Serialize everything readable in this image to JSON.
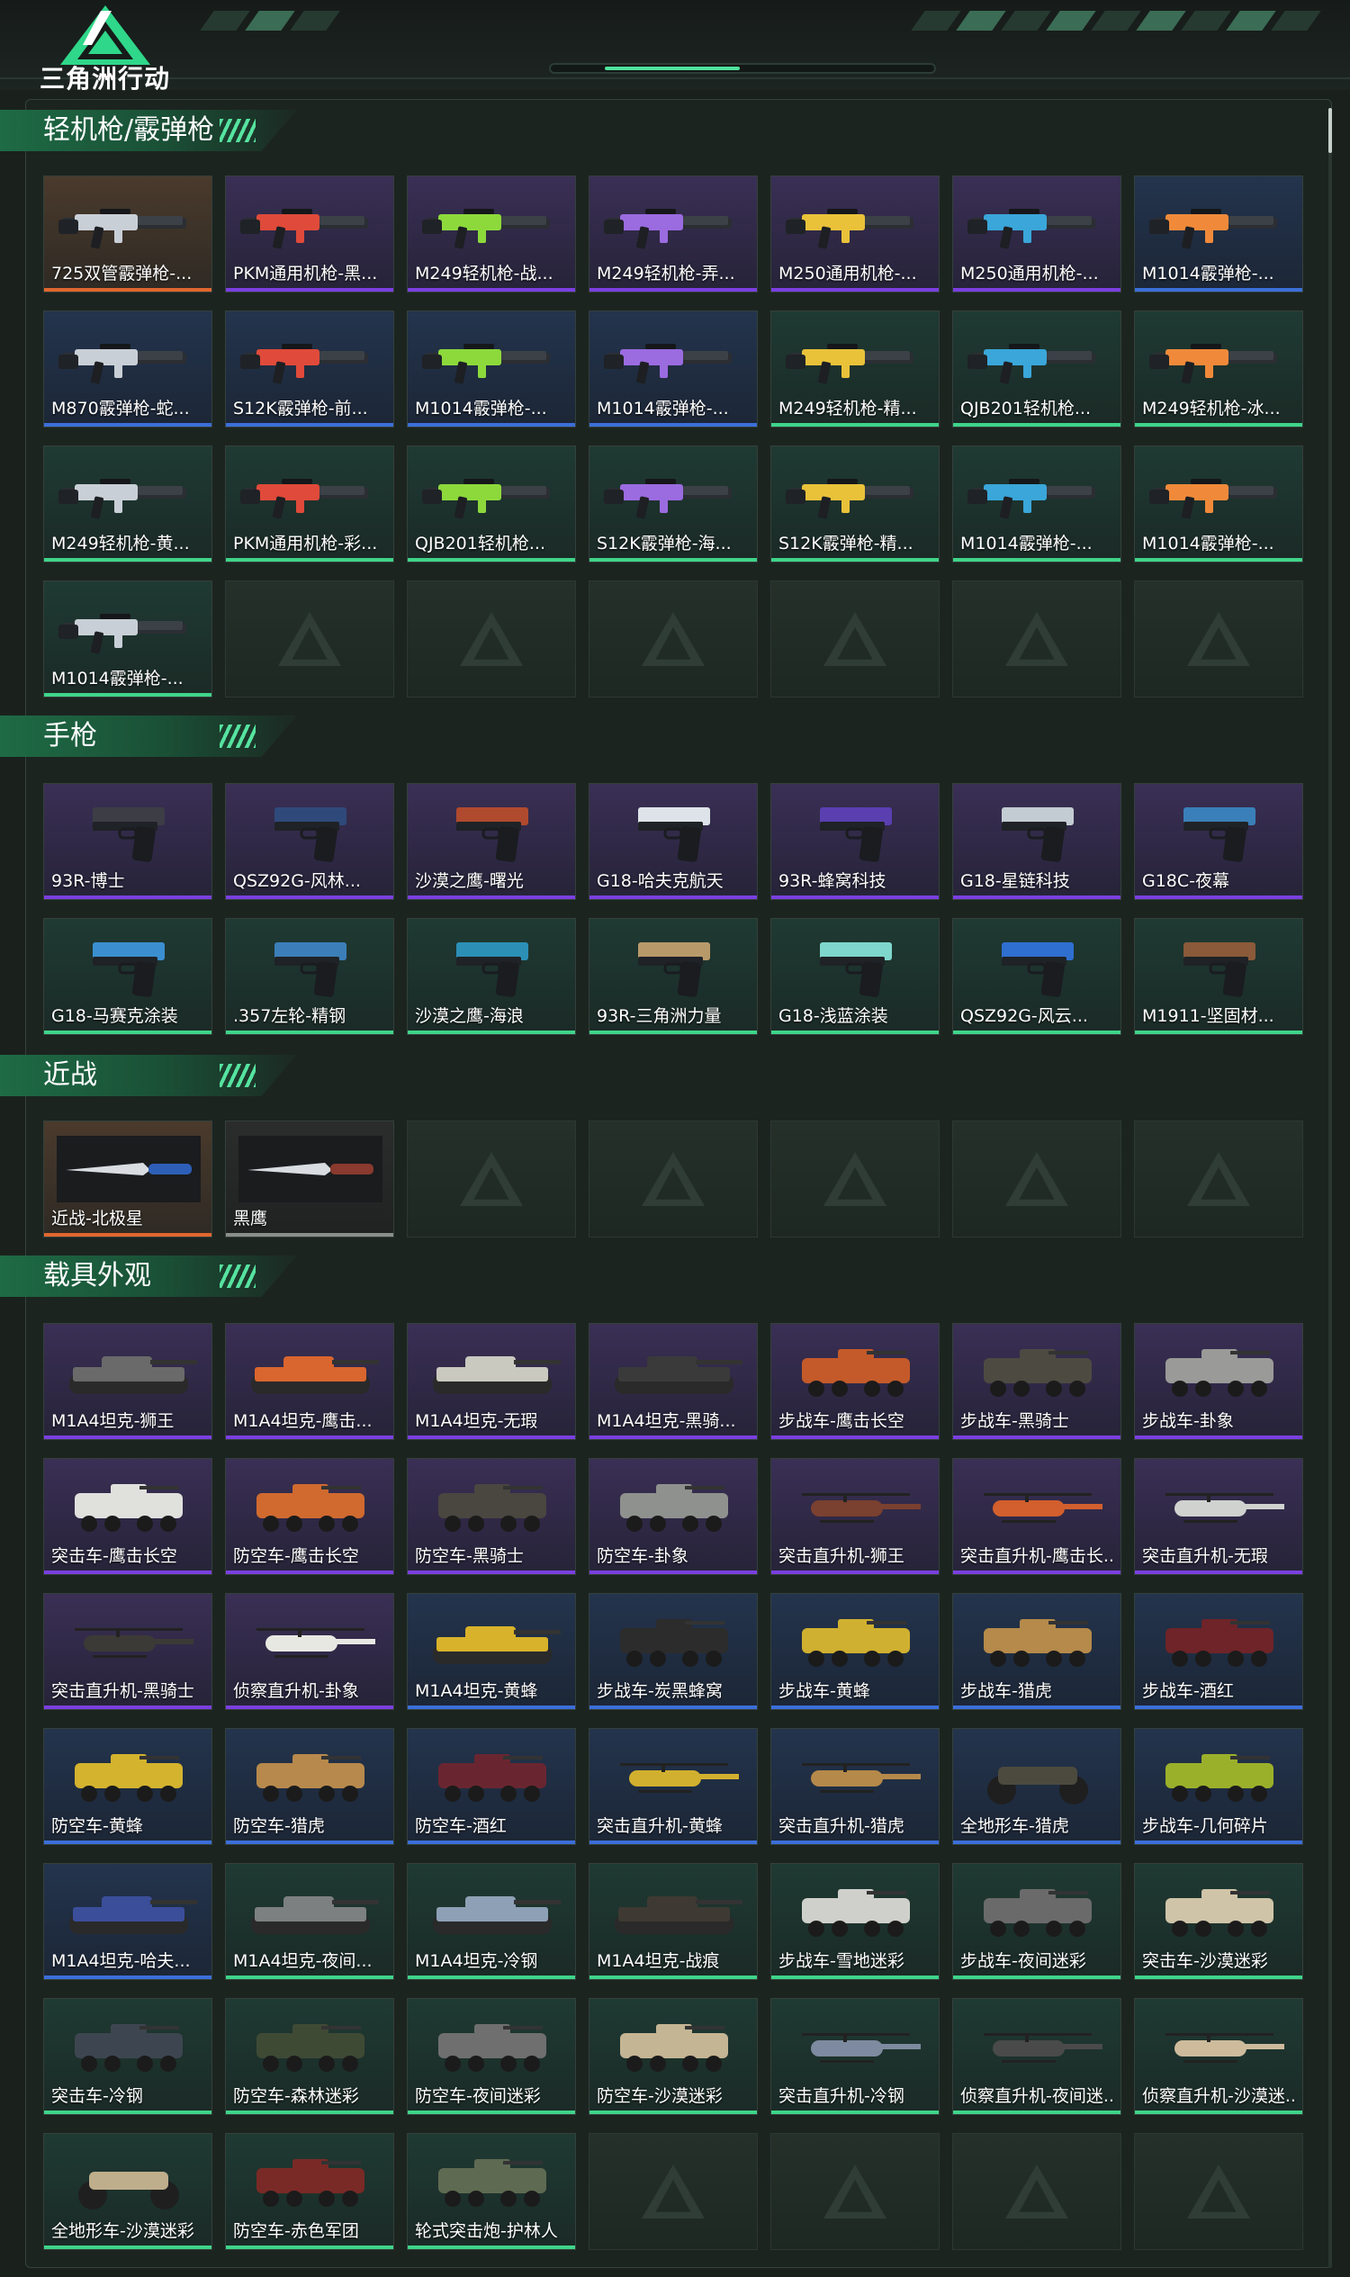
{
  "header": {
    "logo_text": "三角洲行动"
  },
  "colors": {
    "orange": "#e0662f",
    "purple": "#7b3fe0",
    "blue": "#3b6fd9",
    "green": "#3fd48a",
    "gray": "#8a8f8c"
  },
  "sections": [
    {
      "title": "轻机枪/霰弹枪",
      "kind": "gun",
      "items": [
        {
          "name": "725双管霰弹枪-...",
          "rarity": "orange"
        },
        {
          "name": "PKM通用机枪-黑...",
          "rarity": "purple"
        },
        {
          "name": "M249轻机枪-战...",
          "rarity": "purple"
        },
        {
          "name": "M249轻机枪-弄...",
          "rarity": "purple"
        },
        {
          "name": "M250通用机枪-...",
          "rarity": "purple"
        },
        {
          "name": "M250通用机枪-...",
          "rarity": "purple"
        },
        {
          "name": "M1014霰弹枪-...",
          "rarity": "blue"
        },
        {
          "name": "M870霰弹枪-蛇...",
          "rarity": "blue"
        },
        {
          "name": "S12K霰弹枪-前...",
          "rarity": "blue"
        },
        {
          "name": "M1014霰弹枪-...",
          "rarity": "blue"
        },
        {
          "name": "M1014霰弹枪-...",
          "rarity": "blue"
        },
        {
          "name": "M249轻机枪-精...",
          "rarity": "green"
        },
        {
          "name": "QJB201轻机枪...",
          "rarity": "green"
        },
        {
          "name": "M249轻机枪-冰...",
          "rarity": "green"
        },
        {
          "name": "M249轻机枪-黄...",
          "rarity": "green"
        },
        {
          "name": "PKM通用机枪-彩...",
          "rarity": "green"
        },
        {
          "name": "QJB201轻机枪...",
          "rarity": "green"
        },
        {
          "name": "S12K霰弹枪-海...",
          "rarity": "green"
        },
        {
          "name": "S12K霰弹枪-精...",
          "rarity": "green"
        },
        {
          "name": "M1014霰弹枪-...",
          "rarity": "green"
        },
        {
          "name": "M1014霰弹枪-...",
          "rarity": "green"
        },
        {
          "name": "M1014霰弹枪-...",
          "rarity": "green"
        }
      ]
    },
    {
      "title": "手枪",
      "kind": "pistol",
      "items": [
        {
          "name": "93R-博士",
          "rarity": "purple"
        },
        {
          "name": "QSZ92G-风林...",
          "rarity": "purple"
        },
        {
          "name": "沙漠之鹰-曙光",
          "rarity": "purple"
        },
        {
          "name": "G18-哈夫克航天",
          "rarity": "purple"
        },
        {
          "name": "93R-蜂窝科技",
          "rarity": "purple"
        },
        {
          "name": "G18-星链科技",
          "rarity": "purple"
        },
        {
          "name": "G18C-夜幕",
          "rarity": "purple"
        },
        {
          "name": "G18-马赛克涂装",
          "rarity": "green"
        },
        {
          "name": ".357左轮-精钢",
          "rarity": "green"
        },
        {
          "name": "沙漠之鹰-海浪",
          "rarity": "green"
        },
        {
          "name": "93R-三角洲力量",
          "rarity": "green"
        },
        {
          "name": "G18-浅蓝涂装",
          "rarity": "green"
        },
        {
          "name": "QSZ92G-风云...",
          "rarity": "green"
        },
        {
          "name": "M1911-坚固材...",
          "rarity": "green"
        }
      ]
    },
    {
      "title": "近战",
      "kind": "melee",
      "items": [
        {
          "name": "近战-北极星",
          "rarity": "orange"
        },
        {
          "name": "黑鹰",
          "rarity": "gray"
        }
      ]
    },
    {
      "title": "载具外观",
      "kind": "vehicle",
      "items": [
        {
          "name": "M1A4坦克-狮王",
          "rarity": "purple"
        },
        {
          "name": "M1A4坦克-鹰击...",
          "rarity": "purple"
        },
        {
          "name": "M1A4坦克-无瑕",
          "rarity": "purple"
        },
        {
          "name": "M1A4坦克-黑骑...",
          "rarity": "purple"
        },
        {
          "name": "步战车-鹰击长空",
          "rarity": "purple"
        },
        {
          "name": "步战车-黑骑士",
          "rarity": "purple"
        },
        {
          "name": "步战车-卦象",
          "rarity": "purple"
        },
        {
          "name": "突击车-鹰击长空",
          "rarity": "purple"
        },
        {
          "name": "防空车-鹰击长空",
          "rarity": "purple"
        },
        {
          "name": "防空车-黑骑士",
          "rarity": "purple"
        },
        {
          "name": "防空车-卦象",
          "rarity": "purple"
        },
        {
          "name": "突击直升机-狮王",
          "rarity": "purple"
        },
        {
          "name": "突击直升机-鹰击长...",
          "rarity": "purple"
        },
        {
          "name": "突击直升机-无瑕",
          "rarity": "purple"
        },
        {
          "name": "突击直升机-黑骑士",
          "rarity": "purple"
        },
        {
          "name": "侦察直升机-卦象",
          "rarity": "purple"
        },
        {
          "name": "M1A4坦克-黄蜂",
          "rarity": "blue"
        },
        {
          "name": "步战车-炭黑蜂窝",
          "rarity": "blue"
        },
        {
          "name": "步战车-黄蜂",
          "rarity": "blue"
        },
        {
          "name": "步战车-猎虎",
          "rarity": "blue"
        },
        {
          "name": "步战车-酒红",
          "rarity": "blue"
        },
        {
          "name": "防空车-黄蜂",
          "rarity": "blue"
        },
        {
          "name": "防空车-猎虎",
          "rarity": "blue"
        },
        {
          "name": "防空车-酒红",
          "rarity": "blue"
        },
        {
          "name": "突击直升机-黄蜂",
          "rarity": "blue"
        },
        {
          "name": "突击直升机-猎虎",
          "rarity": "blue"
        },
        {
          "name": "全地形车-猎虎",
          "rarity": "blue"
        },
        {
          "name": "步战车-几何碎片",
          "rarity": "blue"
        },
        {
          "name": "M1A4坦克-哈夫...",
          "rarity": "blue"
        },
        {
          "name": "M1A4坦克-夜间...",
          "rarity": "green"
        },
        {
          "name": "M1A4坦克-冷钢",
          "rarity": "green"
        },
        {
          "name": "M1A4坦克-战痕",
          "rarity": "green"
        },
        {
          "name": "步战车-雪地迷彩",
          "rarity": "green"
        },
        {
          "name": "步战车-夜间迷彩",
          "rarity": "green"
        },
        {
          "name": "突击车-沙漠迷彩",
          "rarity": "green"
        },
        {
          "name": "突击车-冷钢",
          "rarity": "green"
        },
        {
          "name": "防空车-森林迷彩",
          "rarity": "green"
        },
        {
          "name": "防空车-夜间迷彩",
          "rarity": "green"
        },
        {
          "name": "防空车-沙漠迷彩",
          "rarity": "green"
        },
        {
          "name": "突击直升机-冷钢",
          "rarity": "green"
        },
        {
          "name": "侦察直升机-夜间迷...",
          "rarity": "green"
        },
        {
          "name": "侦察直升机-沙漠迷...",
          "rarity": "green"
        },
        {
          "name": "全地形车-沙漠迷彩",
          "rarity": "green"
        },
        {
          "name": "防空车-赤色军团",
          "rarity": "green"
        },
        {
          "name": "轮式突击炮-护林人",
          "rarity": "green"
        }
      ]
    }
  ]
}
